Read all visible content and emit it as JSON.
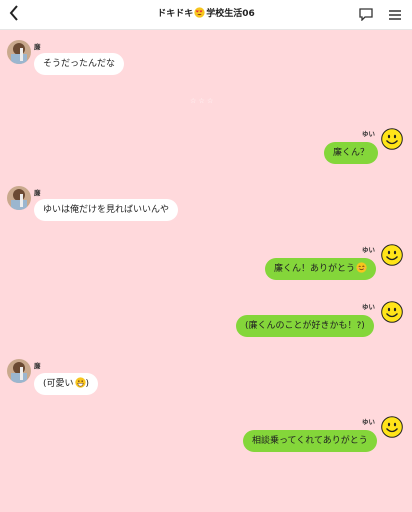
{
  "header": {
    "title_prefix": "ドキドキ",
    "title_suffix": "学校生活06",
    "title_emoji": "heart-eyes-emoji",
    "back_icon": "chevron-left-icon",
    "chat_icon": "speech-bubble-icon",
    "menu_icon": "hamburger-menu-icon"
  },
  "decoration": "☆ ☆ ☆",
  "colors": {
    "background": "#ffd9dc",
    "left_bubble": "#ffffff",
    "right_bubble": "#84d63a"
  },
  "messages": [
    {
      "sender": "廉",
      "side": "left",
      "text": "そうだったんだな"
    },
    {
      "sender": "ゆい",
      "side": "right",
      "text": "廉くん？"
    },
    {
      "sender": "廉",
      "side": "left",
      "text": "ゆいは俺だけを見ればいいんや"
    },
    {
      "sender": "ゆい",
      "side": "right",
      "text": "廉くん！ありがとう",
      "emoji": "smiling-face-emoji"
    },
    {
      "sender": "ゆい",
      "side": "right",
      "text": "(廉くんのことが好きかも！?)"
    },
    {
      "sender": "廉",
      "side": "left",
      "text": "(可愛い",
      "emoji": "grinning-face-emoji",
      "text_after": ")"
    },
    {
      "sender": "ゆい",
      "side": "right",
      "text": "相談乗ってくれてありがとう"
    }
  ]
}
